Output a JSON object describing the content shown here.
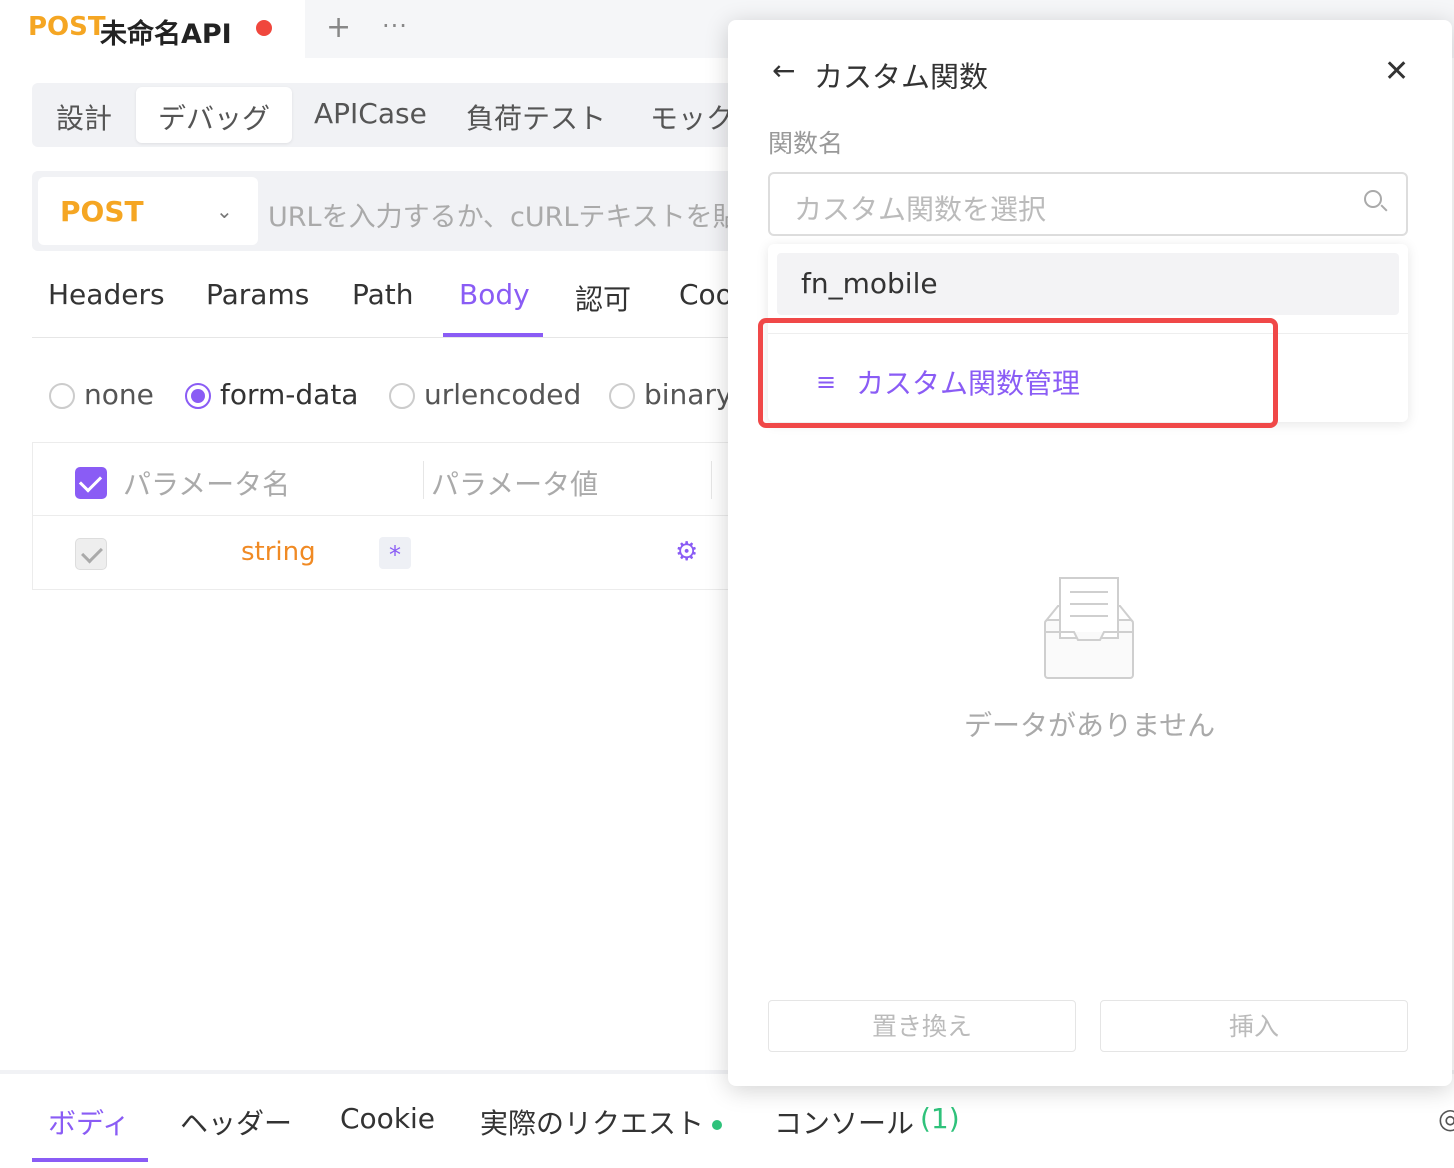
{
  "top_tab": {
    "method": "POST",
    "name": "未命名API"
  },
  "topbar": {
    "plus": "+",
    "more": "···"
  },
  "mode_tabs": [
    "設計",
    "デバッグ",
    "APICase",
    "負荷テスト",
    "モック"
  ],
  "request": {
    "method": "POST",
    "url_placeholder": "URLを入力するか、cURLテキストを貼"
  },
  "request_tabs": [
    "Headers",
    "Params",
    "Path",
    "Body",
    "認可",
    "Coo"
  ],
  "body_types": [
    "none",
    "form-data",
    "urlencoded",
    "binary"
  ],
  "body_type_selected": "form-data",
  "param_table": {
    "headers": [
      "パラメータ名",
      "パラメータ値"
    ],
    "row": {
      "type": "string",
      "required": "*"
    }
  },
  "bottom_tabs": [
    "ボディ",
    "ヘッダー",
    "Cookie",
    "実際のリクエスト",
    "コンソール",
    "(1)"
  ],
  "panel": {
    "title": "カスタム関数",
    "field_label": "関数名",
    "search_placeholder": "カスタム関数を選択",
    "dropdown_items": [
      "fn_mobile"
    ],
    "manage_label": "カスタム関数管理",
    "empty_text": "データがありません",
    "replace_button": "置き換え",
    "insert_button": "挿入"
  },
  "colors": {
    "accent": "#8a5cf5",
    "method": "#f5a623",
    "highlight": "#f04848",
    "type": "#f08a24"
  }
}
